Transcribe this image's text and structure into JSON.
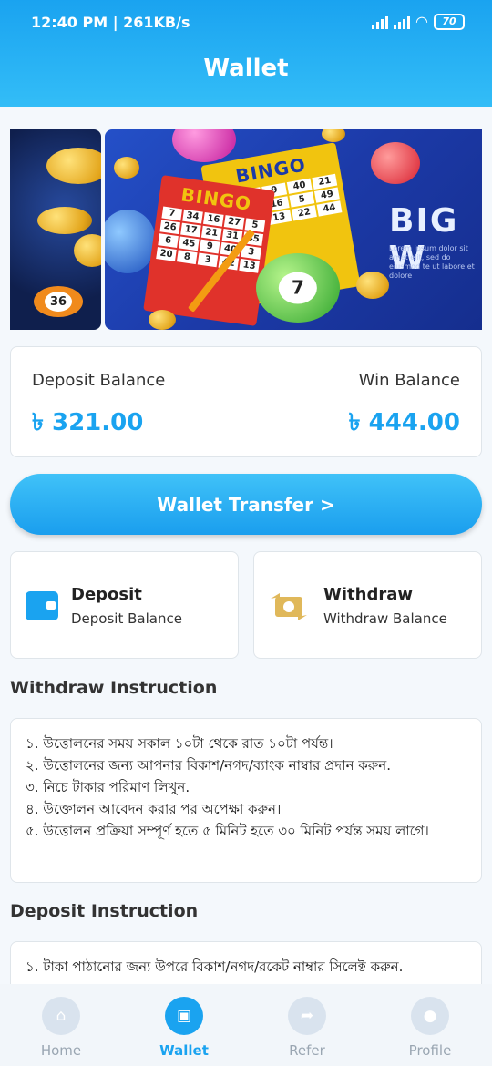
{
  "status": {
    "time": "12:40 PM | 261KB/s",
    "battery": "70"
  },
  "header": {
    "title": "Wallet"
  },
  "banner": {
    "card_text": "BINGO",
    "big_text": "BIG W",
    "lorem": "Lorem ipsum dolor sit amet elit, sed do eiusmod te ut labore et dolore",
    "ball_numbers": [
      "36",
      "7"
    ]
  },
  "balances": {
    "deposit_label": "Deposit Balance",
    "deposit_amount": "৳ 321.00",
    "win_label": "Win Balance",
    "win_amount": "৳ 444.00"
  },
  "transfer_button": "Wallet Transfer >",
  "actions": {
    "deposit_title": "Deposit",
    "deposit_sub": "Deposit Balance",
    "withdraw_title": "Withdraw",
    "withdraw_sub": "Withdraw Balance"
  },
  "withdraw_instruction": {
    "title": "Withdraw Instruction",
    "lines": [
      "১. উত্তোলনের সময় সকাল ১০টা থেকে রাত ১০টা পর্যন্ত।",
      "২. উত্তোলনের জন্য আপনার বিকাশ/নগদ/ব্যাংক নাম্বার প্রদান করুন.",
      "৩. নিচে টাকার পরিমাণ লিখুন.",
      "৪. উক্তোলন আবেদন করার পর অপেক্ষা করুন।",
      "৫. উত্তোলন প্রক্রিয়া সম্পূর্ণ হতে ৫ মিনিট হতে ৩০ মিনিট পর্যন্ত সময় লাগে।"
    ]
  },
  "deposit_instruction": {
    "title": "Deposit Instruction",
    "lines": [
      "১. টাকা পাঠানোর জন্য উপরে বিকাশ/নগদ/রকেট নাম্বার সিলেক্ট করুন."
    ]
  },
  "nav": {
    "items": [
      {
        "label": "Home",
        "icon": "home-icon"
      },
      {
        "label": "Wallet",
        "icon": "wallet-icon"
      },
      {
        "label": "Refer",
        "icon": "share-icon"
      },
      {
        "label": "Profile",
        "icon": "user-icon"
      }
    ],
    "active": "Wallet"
  },
  "colors": {
    "accent": "#1aa3f0",
    "header": "#22aaf2"
  }
}
